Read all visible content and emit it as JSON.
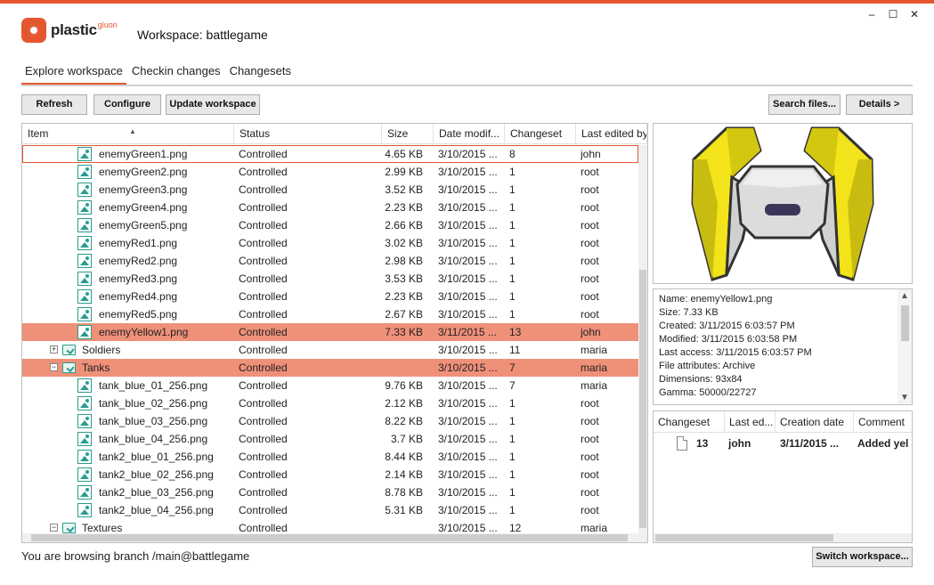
{
  "app": {
    "logo_text": "plastic",
    "logo_sub": "gluon",
    "workspace_title": "Workspace: battlegame",
    "window_controls": {
      "minimize": "–",
      "maximize": "☐",
      "close": "✕"
    },
    "accent_color": "#e4572e"
  },
  "tabs": [
    {
      "label": "Explore workspace",
      "active": true
    },
    {
      "label": "Checkin changes",
      "active": false
    },
    {
      "label": "Changesets",
      "active": false
    }
  ],
  "toolbar": {
    "refresh_label": "Refresh",
    "configure_label": "Configure",
    "update_label": "Update workspace",
    "search_label": "Search files...",
    "details_label": "Details >"
  },
  "grid": {
    "columns": [
      "Item",
      "Status",
      "Size",
      "Date modif...",
      "Changeset",
      "Last edited by"
    ],
    "rows": [
      {
        "type": "file",
        "name": "enemyGreen1.png",
        "status": "Controlled",
        "size": "4.65 KB",
        "date": "3/10/2015 ...",
        "changeset": "8",
        "user": "john",
        "focus": true
      },
      {
        "type": "file",
        "name": "enemyGreen2.png",
        "status": "Controlled",
        "size": "2.99 KB",
        "date": "3/10/2015 ...",
        "changeset": "1",
        "user": "root"
      },
      {
        "type": "file",
        "name": "enemyGreen3.png",
        "status": "Controlled",
        "size": "3.52 KB",
        "date": "3/10/2015 ...",
        "changeset": "1",
        "user": "root"
      },
      {
        "type": "file",
        "name": "enemyGreen4.png",
        "status": "Controlled",
        "size": "2.23 KB",
        "date": "3/10/2015 ...",
        "changeset": "1",
        "user": "root"
      },
      {
        "type": "file",
        "name": "enemyGreen5.png",
        "status": "Controlled",
        "size": "2.66 KB",
        "date": "3/10/2015 ...",
        "changeset": "1",
        "user": "root"
      },
      {
        "type": "file",
        "name": "enemyRed1.png",
        "status": "Controlled",
        "size": "3.02 KB",
        "date": "3/10/2015 ...",
        "changeset": "1",
        "user": "root"
      },
      {
        "type": "file",
        "name": "enemyRed2.png",
        "status": "Controlled",
        "size": "2.98 KB",
        "date": "3/10/2015 ...",
        "changeset": "1",
        "user": "root"
      },
      {
        "type": "file",
        "name": "enemyRed3.png",
        "status": "Controlled",
        "size": "3.53 KB",
        "date": "3/10/2015 ...",
        "changeset": "1",
        "user": "root"
      },
      {
        "type": "file",
        "name": "enemyRed4.png",
        "status": "Controlled",
        "size": "2.23 KB",
        "date": "3/10/2015 ...",
        "changeset": "1",
        "user": "root"
      },
      {
        "type": "file",
        "name": "enemyRed5.png",
        "status": "Controlled",
        "size": "2.67 KB",
        "date": "3/10/2015 ...",
        "changeset": "1",
        "user": "root"
      },
      {
        "type": "file",
        "name": "enemyYellow1.png",
        "status": "Controlled",
        "size": "7.33 KB",
        "date": "3/11/2015 ...",
        "changeset": "13",
        "user": "john",
        "selected": true
      },
      {
        "type": "folder",
        "name": "Soldiers",
        "expander": "+",
        "status": "Controlled",
        "size": "",
        "date": "3/10/2015 ...",
        "changeset": "11",
        "user": "maria"
      },
      {
        "type": "folder",
        "name": "Tanks",
        "expander": "−",
        "status": "Controlled",
        "size": "",
        "date": "3/10/2015 ...",
        "changeset": "7",
        "user": "maria",
        "selected": true
      },
      {
        "type": "file",
        "name": "tank_blue_01_256.png",
        "status": "Controlled",
        "size": "9.76 KB",
        "date": "3/10/2015 ...",
        "changeset": "7",
        "user": "maria"
      },
      {
        "type": "file",
        "name": "tank_blue_02_256.png",
        "status": "Controlled",
        "size": "2.12 KB",
        "date": "3/10/2015 ...",
        "changeset": "1",
        "user": "root"
      },
      {
        "type": "file",
        "name": "tank_blue_03_256.png",
        "status": "Controlled",
        "size": "8.22 KB",
        "date": "3/10/2015 ...",
        "changeset": "1",
        "user": "root"
      },
      {
        "type": "file",
        "name": "tank_blue_04_256.png",
        "status": "Controlled",
        "size": "3.7 KB",
        "date": "3/10/2015 ...",
        "changeset": "1",
        "user": "root"
      },
      {
        "type": "file",
        "name": "tank2_blue_01_256.png",
        "status": "Controlled",
        "size": "8.44 KB",
        "date": "3/10/2015 ...",
        "changeset": "1",
        "user": "root"
      },
      {
        "type": "file",
        "name": "tank2_blue_02_256.png",
        "status": "Controlled",
        "size": "2.14 KB",
        "date": "3/10/2015 ...",
        "changeset": "1",
        "user": "root"
      },
      {
        "type": "file",
        "name": "tank2_blue_03_256.png",
        "status": "Controlled",
        "size": "8.78 KB",
        "date": "3/10/2015 ...",
        "changeset": "1",
        "user": "root"
      },
      {
        "type": "file",
        "name": "tank2_blue_04_256.png",
        "status": "Controlled",
        "size": "5.31 KB",
        "date": "3/10/2015 ...",
        "changeset": "1",
        "user": "root"
      },
      {
        "type": "folder",
        "name": "Textures",
        "expander": "−",
        "status": "Controlled",
        "size": "",
        "date": "3/10/2015 ...",
        "changeset": "12",
        "user": "maria"
      }
    ]
  },
  "details": {
    "lines": [
      "Name: enemyYellow1.png",
      "Size: 7.33 KB",
      "Created: 3/11/2015 6:03:57 PM",
      "Modified: 3/11/2015 6:03:58 PM",
      "Last access: 3/11/2015 6:03:57 PM",
      "File attributes: Archive",
      "Dimensions: 93x84",
      "Gamma: 50000/22727"
    ]
  },
  "changesets": {
    "columns": [
      "Changeset",
      "Last ed...",
      "Creation date",
      "Comment"
    ],
    "rows": [
      {
        "changeset": "13",
        "user": "john",
        "date": "3/11/2015 ...",
        "comment": "Added yel"
      }
    ]
  },
  "status_bar": {
    "branch_text": "You are browsing branch /main@battlegame",
    "switch_label": "Switch workspace..."
  }
}
